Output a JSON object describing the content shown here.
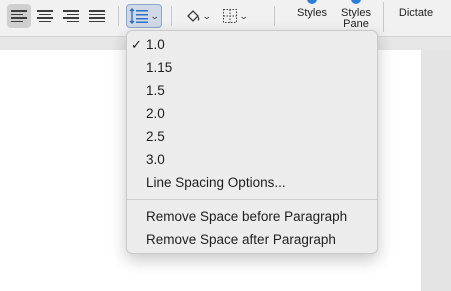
{
  "toolbar": {
    "buttons": [
      {
        "name": "align-left-button",
        "selected": true
      },
      {
        "name": "align-center-button",
        "selected": false
      },
      {
        "name": "align-right-button",
        "selected": false
      },
      {
        "name": "justify-button",
        "selected": false
      }
    ],
    "line_spacing_icon": "line-spacing-icon",
    "shading_icon": "paint-bucket-icon",
    "borders_icon": "borders-icon",
    "styles_label": "Styles",
    "styles_pane_label_1": "Styles",
    "styles_pane_label_2": "Pane",
    "dictate_label": "Dictate"
  },
  "menu": {
    "items": [
      {
        "label": "1.0",
        "checked": true
      },
      {
        "label": "1.15",
        "checked": false
      },
      {
        "label": "1.5",
        "checked": false
      },
      {
        "label": "2.0",
        "checked": false
      },
      {
        "label": "2.5",
        "checked": false
      },
      {
        "label": "3.0",
        "checked": false
      },
      {
        "label": "Line Spacing Options...",
        "checked": false
      }
    ],
    "check_mark": "✓",
    "paragraph_items": [
      {
        "label": "Remove Space before Paragraph"
      },
      {
        "label": "Remove Space after Paragraph"
      }
    ]
  },
  "colors": {
    "accent": "#2f7ed8",
    "menu_bg": "#ececec",
    "toolbar_bg": "#f1f1f1"
  }
}
